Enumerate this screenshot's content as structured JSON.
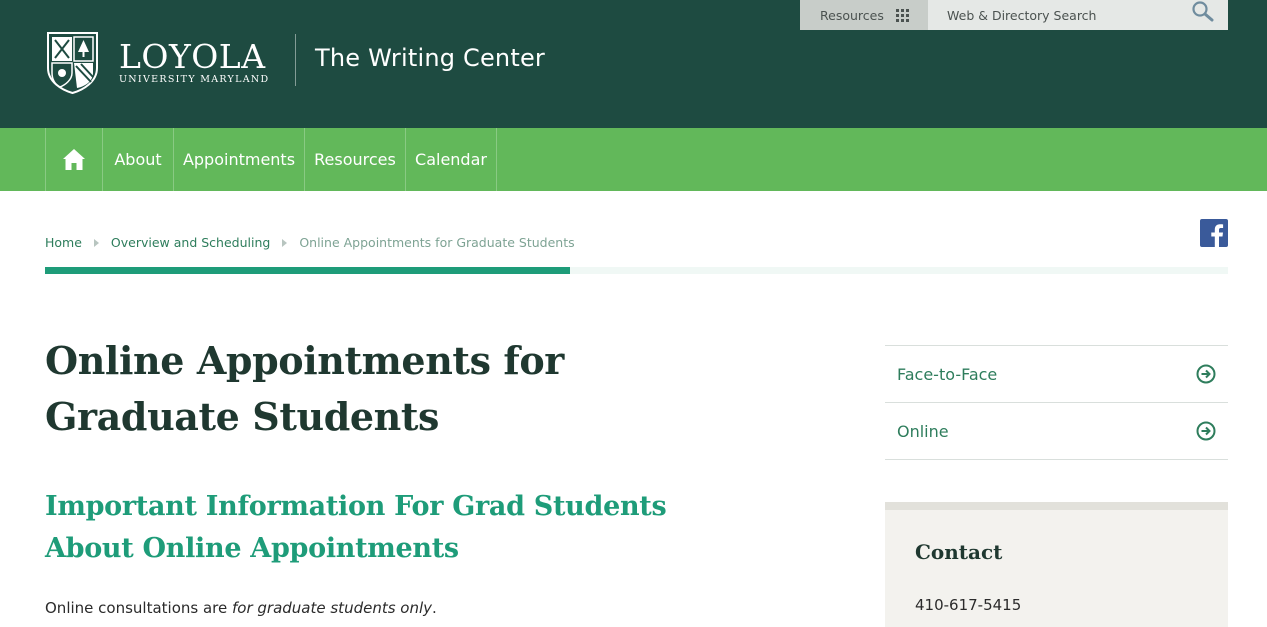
{
  "header": {
    "brand_main": "LOYOLA",
    "brand_sub": "UNIVERSITY MARYLAND",
    "site_name": "The Writing Center",
    "resources_label": "Resources",
    "search_placeholder": "Web & Directory Search",
    "icons": [
      "university-shield-logo",
      "grid-icon",
      "search-icon"
    ]
  },
  "nav": {
    "items": [
      {
        "label": "",
        "icon": "home-icon"
      },
      {
        "label": "About"
      },
      {
        "label": "Appointments"
      },
      {
        "label": "Resources"
      },
      {
        "label": "Calendar"
      }
    ]
  },
  "breadcrumb": {
    "items": [
      "Home",
      "Overview and Scheduling",
      "Online Appointments for Graduate Students"
    ],
    "progress": 0.444
  },
  "social": {
    "icon": "facebook-icon"
  },
  "main": {
    "title": "Online Appointments for Graduate Students",
    "section_heading": "Important Information For Grad Students About Online Appointments",
    "intro_prefix": "Online consultations are ",
    "intro_emphasis": "for graduate students only",
    "intro_suffix": "."
  },
  "sidebar": {
    "links": [
      {
        "label": "Face-to-Face",
        "icon": "circle-arrow-right-icon"
      },
      {
        "label": "Online",
        "icon": "circle-arrow-right-icon"
      }
    ],
    "contact": {
      "heading": "Contact",
      "phone": "410-617-5415"
    }
  },
  "colors": {
    "header_bg": "#1e4b41",
    "nav_bg": "#62b85a",
    "accent": "#1e9c79",
    "link": "#2e7d5c",
    "facebook": "#3a5a9a"
  }
}
